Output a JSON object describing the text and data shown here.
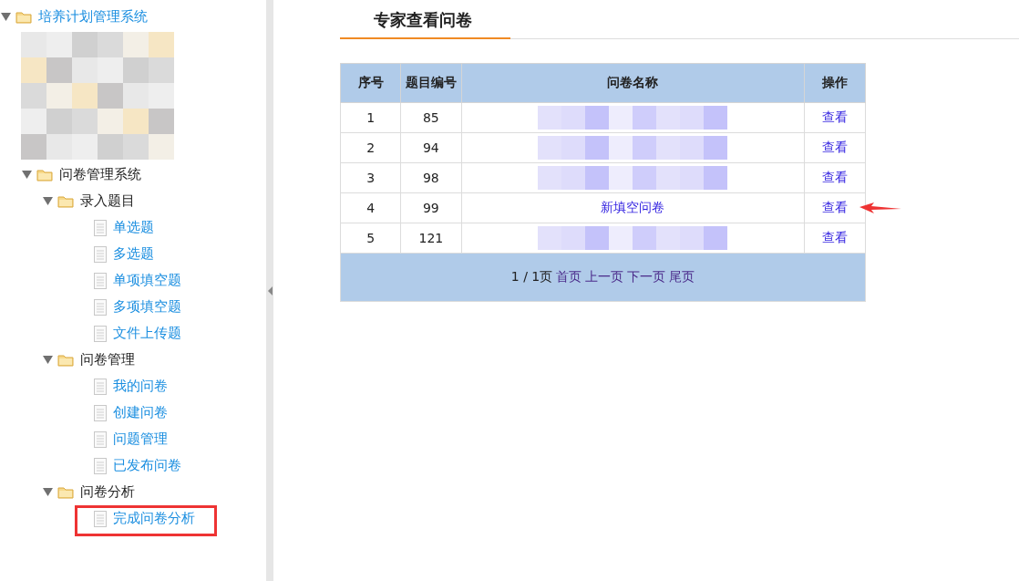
{
  "sidebar": {
    "tree": [
      {
        "kind": "folder",
        "label": "培养计划管理系统",
        "expanded": true,
        "link": true,
        "children": [
          {
            "kind": "redacted"
          },
          {
            "kind": "folder",
            "label": "问卷管理系统",
            "expanded": true,
            "link": false,
            "children": [
              {
                "kind": "folder",
                "label": "录入题目",
                "expanded": true,
                "link": false,
                "children": [
                  {
                    "kind": "file",
                    "label": "单选题",
                    "highlighted": false
                  },
                  {
                    "kind": "file",
                    "label": "多选题",
                    "highlighted": false
                  },
                  {
                    "kind": "file",
                    "label": "单项填空题",
                    "highlighted": false
                  },
                  {
                    "kind": "file",
                    "label": "多项填空题",
                    "highlighted": false
                  },
                  {
                    "kind": "file",
                    "label": "文件上传题",
                    "highlighted": false
                  }
                ]
              },
              {
                "kind": "folder",
                "label": "问卷管理",
                "expanded": true,
                "link": false,
                "children": [
                  {
                    "kind": "file",
                    "label": "我的问卷",
                    "highlighted": false
                  },
                  {
                    "kind": "file",
                    "label": "创建问卷",
                    "highlighted": false
                  },
                  {
                    "kind": "file",
                    "label": "问题管理",
                    "highlighted": false
                  },
                  {
                    "kind": "file",
                    "label": "已发布问卷",
                    "highlighted": false
                  }
                ]
              },
              {
                "kind": "folder",
                "label": "问卷分析",
                "expanded": true,
                "link": false,
                "children": [
                  {
                    "kind": "file",
                    "label": "完成问卷分析",
                    "highlighted": true
                  }
                ]
              }
            ]
          }
        ]
      }
    ]
  },
  "main": {
    "title": "专家查看问卷",
    "table": {
      "columns": [
        "序号",
        "题目编号",
        "问卷名称",
        "操作"
      ],
      "rows": [
        {
          "index": "1",
          "number": "85",
          "redacted": true,
          "action": "查看",
          "pointed": false
        },
        {
          "index": "2",
          "number": "94",
          "redacted": true,
          "action": "查看",
          "pointed": false
        },
        {
          "index": "3",
          "number": "98",
          "redacted": true,
          "action": "查看",
          "pointed": false
        },
        {
          "index": "4",
          "number": "99",
          "redacted": false,
          "name": "新填空问卷",
          "action": "查看",
          "pointed": true
        },
        {
          "index": "5",
          "number": "121",
          "redacted": true,
          "action": "查看",
          "pointed": false
        }
      ],
      "pager": {
        "info": "1 / 1页",
        "links": [
          "首页",
          "上一页",
          "下一页",
          "尾页"
        ]
      }
    }
  }
}
